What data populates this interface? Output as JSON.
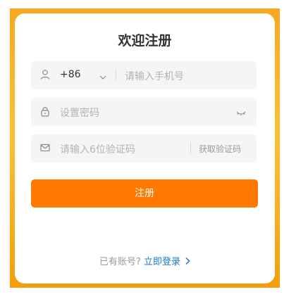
{
  "form": {
    "title": "欢迎注册",
    "phone": {
      "icon": "user-icon",
      "country_code": "+86",
      "placeholder": "请输入手机号"
    },
    "password": {
      "icon": "lock-icon",
      "placeholder": "设置密码",
      "toggle_icon": "eye-closed-icon"
    },
    "verify_code": {
      "icon": "mail-icon",
      "placeholder": "请输入6位验证码",
      "get_code_label": "获取验证码"
    },
    "submit_label": "注册",
    "login_prompt": "已有账号?",
    "login_link": "立即登录"
  },
  "colors": {
    "frame": "#f9b12a",
    "primary": "#ff7800",
    "link": "#1677d2",
    "field_bg": "#f5f5f6"
  }
}
